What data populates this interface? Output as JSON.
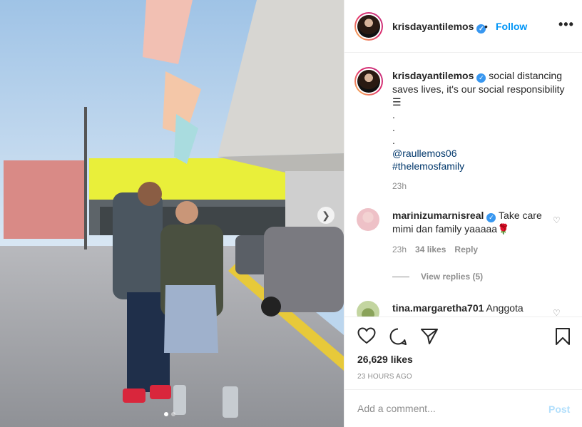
{
  "post": {
    "image_alt": "",
    "carousel": {
      "next_icon": "chevron-right-icon",
      "dots": 2,
      "active_dot": 1
    }
  },
  "header": {
    "username": "krisdayantilemos",
    "verified_icon": "verified-badge-icon",
    "bullet": "•",
    "follow_label": "Follow",
    "more_icon": "more-options-icon",
    "more_label": "•••"
  },
  "caption": {
    "username": "krisdayantilemos",
    "text_lines": [
      "social distancing saves lives, it's our social responsibility ☰",
      ".",
      ".",
      "."
    ],
    "mention": "@raullemos06",
    "hashtag": "#thelemosfamily",
    "time": "23h"
  },
  "comments": [
    {
      "username": "marinizumarnisreal",
      "text": "Take care mimi dan family yaaaaa🌹",
      "time": "23h",
      "likes": "34 likes",
      "reply_label": "Reply",
      "view_replies": "View replies (5)"
    },
    {
      "username": "tina.margaretha701",
      "text": "Anggota"
    }
  ],
  "actions": {
    "like_icon": "heart-icon",
    "comment_icon": "comment-icon",
    "share_icon": "share-icon",
    "save_icon": "bookmark-icon",
    "likes": "26,629 likes",
    "time_ago": "23 HOURS AGO"
  },
  "add_comment": {
    "placeholder": "Add a comment...",
    "post_label": "Post"
  },
  "colors": {
    "accent": "#0095f6",
    "link": "#00376b",
    "muted": "#8e8e8e",
    "post_disabled": "#b2dffc"
  }
}
